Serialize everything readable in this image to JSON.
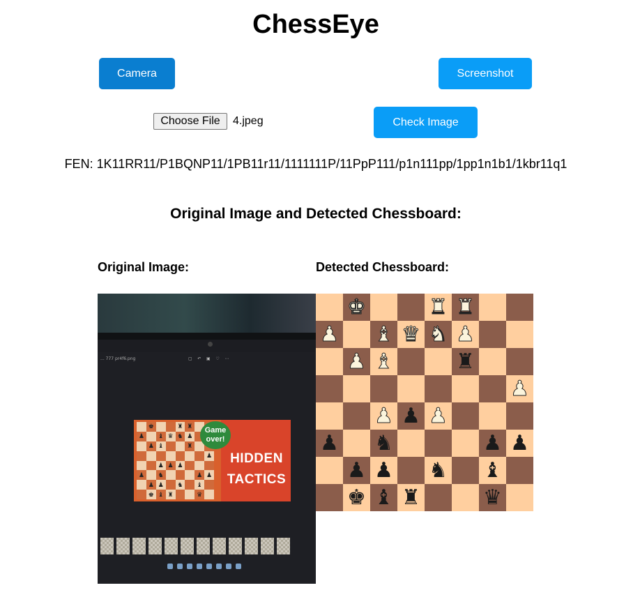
{
  "app": {
    "title": "ChessEye"
  },
  "buttons": {
    "camera": "Camera",
    "screenshot": "Screenshot",
    "check_image": "Check Image",
    "choose_file": "Choose File"
  },
  "file": {
    "name": "4.jpeg"
  },
  "fen": "FEN: 1K11RR11/P1BQNP11/1PB11r11/1111111P/11PpP111/p1n111pp/1pp1n1b1/1kbr11q1",
  "section_title": "Original Image and Detected Chessboard:",
  "labels": {
    "original": "Original Image:",
    "detected": "Detected Chessboard:"
  },
  "photo": {
    "toolbar_text": "...  777 pr4f6.png",
    "toolbar_icons": "▢ ↶ ▣ ♡ ⋯",
    "bubble": "Game over!",
    "banner_line1": "HIDDEN",
    "banner_line2": "TACTICS"
  },
  "board": {
    "ranks": [
      [
        "",
        "K",
        "",
        "",
        "R",
        "R",
        "",
        ""
      ],
      [
        "P",
        "",
        "B",
        "Q",
        "N",
        "P",
        "",
        ""
      ],
      [
        "",
        "P",
        "B",
        "",
        "",
        "r",
        "",
        ""
      ],
      [
        "",
        "",
        "",
        "",
        "",
        "",
        "",
        "P"
      ],
      [
        "",
        "",
        "P",
        "p",
        "P",
        "",
        "",
        ""
      ],
      [
        "p",
        "",
        "n",
        "",
        "",
        "",
        "p",
        "p"
      ],
      [
        "",
        "p",
        "p",
        "",
        "n",
        "",
        "b",
        ""
      ],
      [
        "",
        "k",
        "b",
        "r",
        "",
        "",
        "q",
        ""
      ]
    ],
    "colors": {
      "light": "#ffcf9f",
      "dark": "#8b5d4b"
    }
  }
}
